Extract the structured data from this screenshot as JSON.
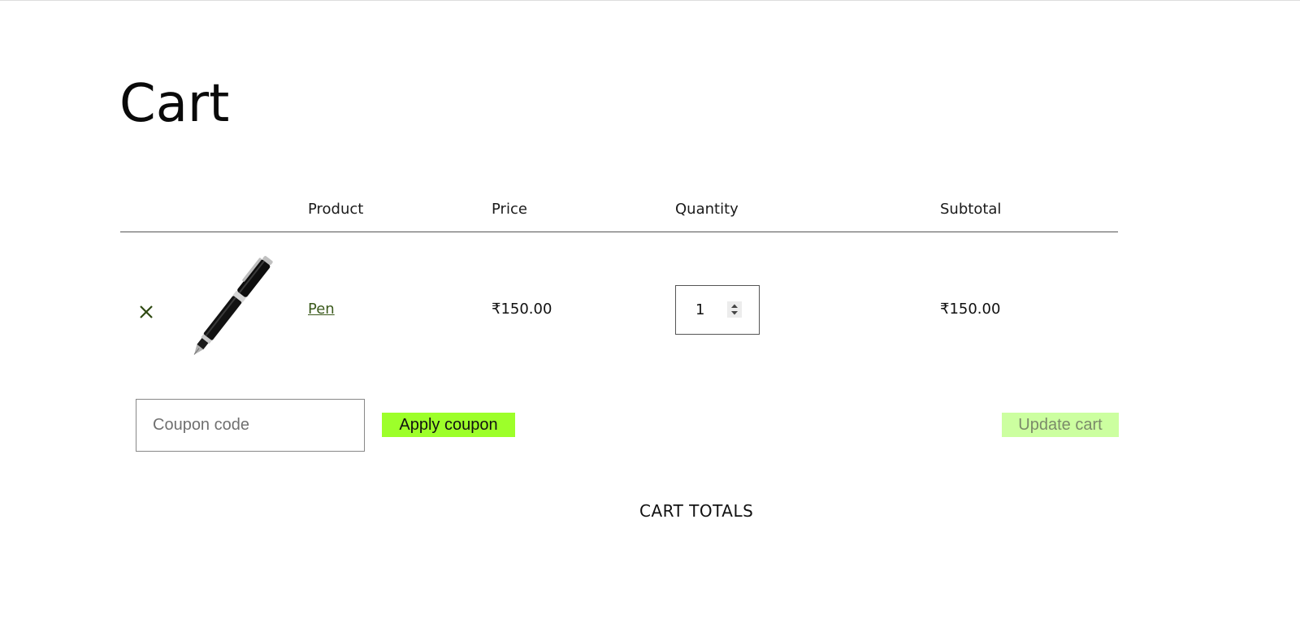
{
  "page": {
    "title": "Cart"
  },
  "cart_table": {
    "headers": {
      "product": "Product",
      "price": "Price",
      "quantity": "Quantity",
      "subtotal": "Subtotal"
    },
    "rows": [
      {
        "remove_icon": "close-icon",
        "thumbnail": "fountain-pen-image",
        "product_name": "Pen",
        "price": "₹150.00",
        "quantity": "1",
        "subtotal": "₹150.00"
      }
    ]
  },
  "coupon": {
    "placeholder": "Coupon code",
    "apply_label": "Apply coupon"
  },
  "actions": {
    "update_label": "Update cart"
  },
  "cart_totals": {
    "heading": "CART TOTALS"
  },
  "colors": {
    "accent": "#9dff2a",
    "accent_disabled": "#ccffa0",
    "link": "#3b5a1c",
    "remove_icon": "#2f4a12"
  }
}
